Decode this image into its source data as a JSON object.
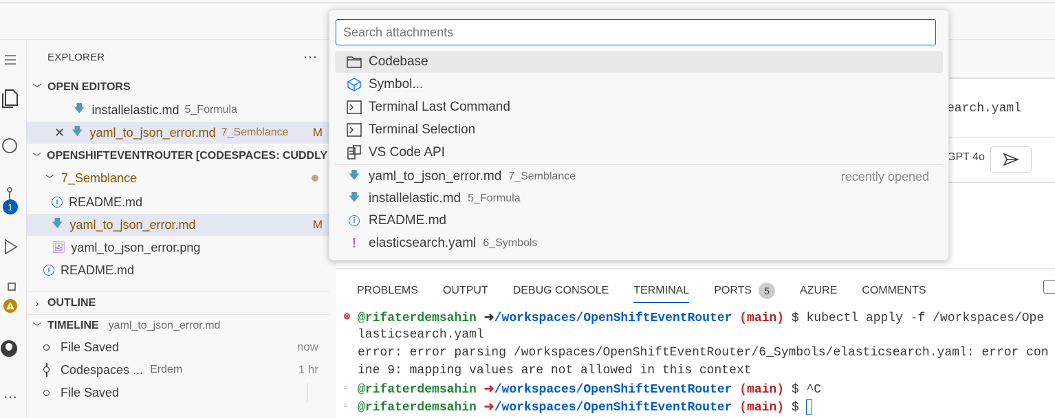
{
  "explorer": {
    "title": "EXPLORER",
    "more": "···",
    "open_editors": {
      "header": "OPEN EDITORS",
      "items": [
        {
          "name": "installelastic.md",
          "folder": "5_Formula"
        },
        {
          "name": "yaml_to_json_error.md",
          "folder": "7_Semblance",
          "status": "M"
        }
      ]
    },
    "workspace": {
      "header": "OPENSHIFTEVENTROUTER [CODESPACES: CUDDLY ...",
      "folder": "7_Semblance",
      "files": [
        {
          "name": "README.md"
        },
        {
          "name": "yaml_to_json_error.md",
          "status": "M"
        },
        {
          "name": "yaml_to_json_error.png"
        }
      ],
      "root_file": "README.md"
    },
    "outline": "OUTLINE",
    "timeline": {
      "header": "TIMELINE",
      "file": "yaml_to_json_error.md",
      "entries": [
        {
          "label": "File Saved",
          "time": "now"
        },
        {
          "label": "Codespaces ...",
          "author": "Erdem",
          "time": "1 hr"
        },
        {
          "label": "File Saved",
          "time": ""
        }
      ]
    }
  },
  "activity": {
    "scm_badge": "1"
  },
  "quickpick": {
    "placeholder": "Search attachments",
    "items": [
      {
        "label": "Codebase",
        "icon": "folder-icon"
      },
      {
        "label": "Symbol...",
        "icon": "symbol-icon"
      },
      {
        "label": "Terminal Last Command",
        "icon": "terminal-icon"
      },
      {
        "label": "Terminal Selection",
        "icon": "terminal-icon"
      },
      {
        "label": "VS Code API",
        "icon": "api-icon"
      }
    ],
    "recent_label": "recently opened",
    "recent": [
      {
        "name": "yaml_to_json_error.md",
        "folder": "7_Semblance"
      },
      {
        "name": "installelastic.md",
        "folder": "5_Formula"
      },
      {
        "name": "README.md",
        "folder": ""
      },
      {
        "name": "elasticsearch.yaml",
        "folder": "6_Symbols"
      }
    ]
  },
  "chat": {
    "snippet": "earch.yaml",
    "model": "GPT 4o"
  },
  "panel": {
    "tabs": [
      "PROBLEMS",
      "OUTPUT",
      "DEBUG CONSOLE",
      "TERMINAL",
      "PORTS",
      "AZURE",
      "COMMENTS"
    ],
    "ports_count": "5",
    "terminal": {
      "user": "@rifaterdemsahin",
      "arrow": "➜",
      "path": "/workspaces/OpenShiftEventRouter",
      "branch_open": "(",
      "branch": "main",
      "branch_close": ")",
      "prompt": "$",
      "cmd1": "kubectl apply -f /workspaces/Ope",
      "cont1": "lasticsearch.yaml",
      "err1": "error: error parsing /workspaces/OpenShiftEventRouter/6_Symbols/elasticsearch.yaml: error con",
      "err2": "ine 9: mapping values are not allowed in this context",
      "cmd2": "^C"
    }
  }
}
